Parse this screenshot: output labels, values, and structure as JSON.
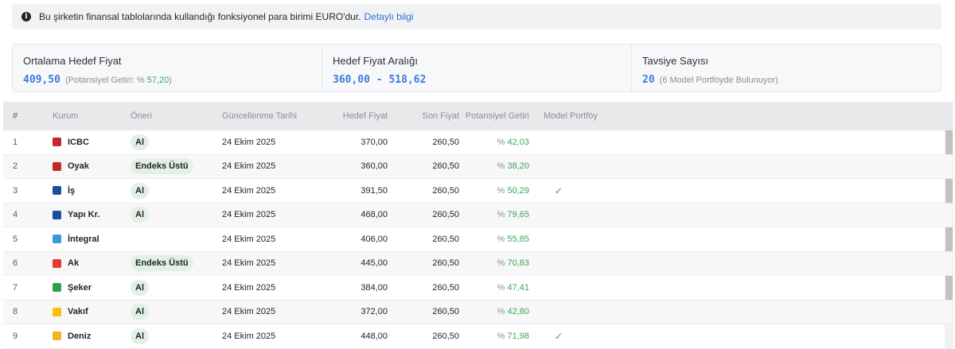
{
  "notice": {
    "text": "Bu şirketin finansal tablolarında kullandığı fonksiyonel para birimi EURO'dur.",
    "link": "Detaylı bilgi"
  },
  "stats": {
    "avg": {
      "label": "Ortalama Hedef Fiyat",
      "value": "409,50",
      "sub_prefix": "(Potansiyel Getiri: ",
      "sub_pct": "%",
      "sub_value": "57,20",
      "sub_suffix": ")"
    },
    "range": {
      "label": "Hedef Fiyat Aralığı",
      "value": "360,00 - 518,62"
    },
    "count": {
      "label": "Tavsiye Sayısı",
      "value": "20",
      "sub": "(6 Model Portföyde Bulunuyor)"
    }
  },
  "table": {
    "headers": [
      "#",
      "Kurum",
      "Öneri",
      "Güncellenme Tarihi",
      "Hedef Fiyat",
      "Son Fiyat",
      "Potansiyel Getiri",
      "Model Portföy"
    ],
    "rows": [
      {
        "idx": "1",
        "kurum": "ICBC",
        "icon": "icbc-icon",
        "color": "#c8272d",
        "oneri": "Al",
        "tarih": "24 Ekim 2025",
        "hedef": "370,00",
        "son": "260,50",
        "getiri": "42,03",
        "model": ""
      },
      {
        "idx": "2",
        "kurum": "Oyak",
        "icon": "oyak-icon",
        "color": "#c62828",
        "oneri": "Endeks Üstü",
        "tarih": "24 Ekim 2025",
        "hedef": "360,00",
        "son": "260,50",
        "getiri": "38,20",
        "model": ""
      },
      {
        "idx": "3",
        "kurum": "İş",
        "icon": "is-icon",
        "color": "#1d4ea0",
        "oneri": "Al",
        "tarih": "24 Ekim 2025",
        "hedef": "391,50",
        "son": "260,50",
        "getiri": "50,29",
        "model": "✓"
      },
      {
        "idx": "4",
        "kurum": "Yapı Kr.",
        "icon": "yapikredi-icon",
        "color": "#1f4f9c",
        "oneri": "Al",
        "tarih": "24 Ekim 2025",
        "hedef": "468,00",
        "son": "260,50",
        "getiri": "79,65",
        "model": ""
      },
      {
        "idx": "5",
        "kurum": "İntegral",
        "icon": "integral-icon",
        "color": "#3a9ad9",
        "oneri": "",
        "tarih": "24 Ekim 2025",
        "hedef": "406,00",
        "son": "260,50",
        "getiri": "55,85",
        "model": ""
      },
      {
        "idx": "6",
        "kurum": "Ak",
        "icon": "ak-icon",
        "color": "#e53935",
        "oneri": "Endeks Üstü",
        "tarih": "24 Ekim 2025",
        "hedef": "445,00",
        "son": "260,50",
        "getiri": "70,83",
        "model": ""
      },
      {
        "idx": "7",
        "kurum": "Şeker",
        "icon": "seker-icon",
        "color": "#2e9e4f",
        "oneri": "Al",
        "tarih": "24 Ekim 2025",
        "hedef": "384,00",
        "son": "260,50",
        "getiri": "47,41",
        "model": ""
      },
      {
        "idx": "8",
        "kurum": "Vakıf",
        "icon": "vakif-icon",
        "color": "#f4c20d",
        "oneri": "Al",
        "tarih": "24 Ekim 2025",
        "hedef": "372,00",
        "son": "260,50",
        "getiri": "42,80",
        "model": ""
      },
      {
        "idx": "9",
        "kurum": "Deniz",
        "icon": "deniz-icon",
        "color": "#f0b323",
        "oneri": "Al",
        "tarih": "24 Ekim 2025",
        "hedef": "448,00",
        "son": "260,50",
        "getiri": "71,98",
        "model": "✓"
      }
    ]
  },
  "colors": {
    "accent": "#3d7ad9",
    "positive": "#3aa55a",
    "badge_bg": "#e3f0e6"
  }
}
